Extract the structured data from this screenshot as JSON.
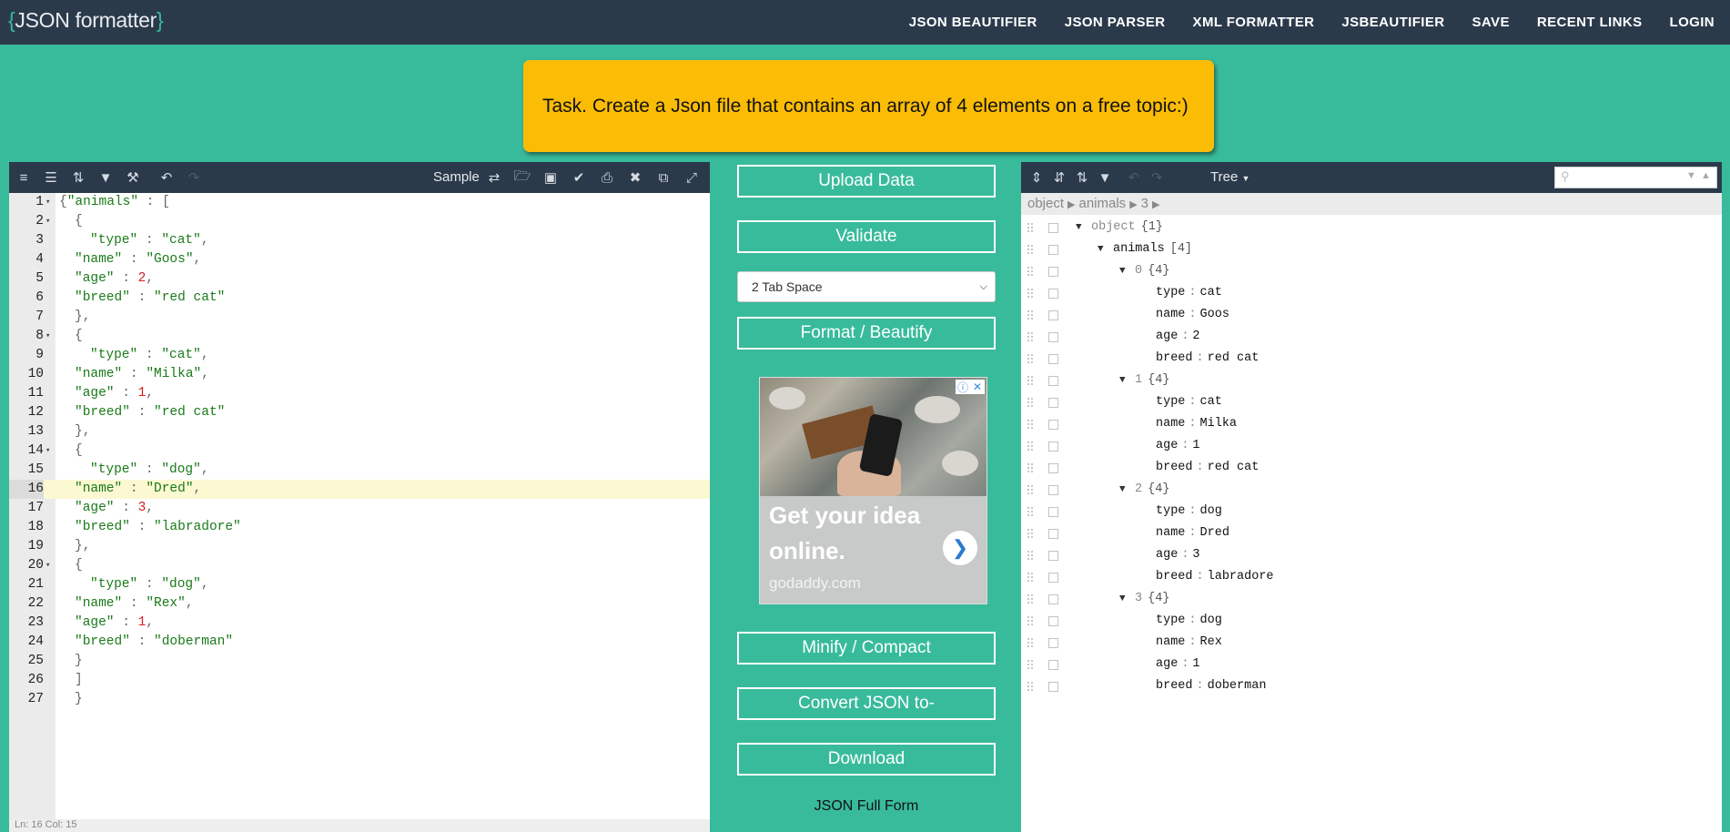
{
  "header": {
    "logo_open": "{",
    "logo_text": "JSON formatter",
    "logo_close": "}",
    "nav": [
      "JSON BEAUTIFIER",
      "JSON PARSER",
      "XML FORMATTER",
      "JSBEAUTIFIER",
      "SAVE",
      "RECENT LINKS",
      "LOGIN"
    ]
  },
  "task": "Task. Create a Json file that contains an array of 4 elements on a free topic:)",
  "editor": {
    "sample_label": "Sample",
    "status": "Ln: 16    Col: 15",
    "active_line": 16,
    "lines": [
      {
        "n": "1",
        "fold": true,
        "indent": 0,
        "parts": [
          {
            "t": "p",
            "v": "{"
          },
          {
            "t": "s",
            "v": "\"animals\""
          },
          {
            "t": "p",
            "v": " : ["
          }
        ]
      },
      {
        "n": "2",
        "fold": true,
        "indent": 1,
        "parts": [
          {
            "t": "p",
            "v": "{"
          }
        ]
      },
      {
        "n": "3",
        "indent": 2,
        "parts": [
          {
            "t": "s",
            "v": "\"type\""
          },
          {
            "t": "p",
            "v": " : "
          },
          {
            "t": "s",
            "v": "\"cat\""
          },
          {
            "t": "p",
            "v": ","
          }
        ]
      },
      {
        "n": "4",
        "indent": 1,
        "parts": [
          {
            "t": "s",
            "v": "\"name\""
          },
          {
            "t": "p",
            "v": " : "
          },
          {
            "t": "s",
            "v": "\"Goos\""
          },
          {
            "t": "p",
            "v": ","
          }
        ]
      },
      {
        "n": "5",
        "indent": 1,
        "parts": [
          {
            "t": "s",
            "v": "\"age\""
          },
          {
            "t": "p",
            "v": " : "
          },
          {
            "t": "n",
            "v": "2"
          },
          {
            "t": "p",
            "v": ","
          }
        ]
      },
      {
        "n": "6",
        "indent": 1,
        "parts": [
          {
            "t": "s",
            "v": "\"breed\""
          },
          {
            "t": "p",
            "v": " : "
          },
          {
            "t": "s",
            "v": "\"red cat\""
          }
        ]
      },
      {
        "n": "7",
        "indent": 1,
        "parts": [
          {
            "t": "p",
            "v": "},"
          }
        ]
      },
      {
        "n": "8",
        "fold": true,
        "indent": 1,
        "parts": [
          {
            "t": "p",
            "v": "{"
          }
        ]
      },
      {
        "n": "9",
        "indent": 2,
        "parts": [
          {
            "t": "s",
            "v": "\"type\""
          },
          {
            "t": "p",
            "v": " : "
          },
          {
            "t": "s",
            "v": "\"cat\""
          },
          {
            "t": "p",
            "v": ","
          }
        ]
      },
      {
        "n": "10",
        "indent": 1,
        "parts": [
          {
            "t": "s",
            "v": "\"name\""
          },
          {
            "t": "p",
            "v": " : "
          },
          {
            "t": "s",
            "v": "\"Milka\""
          },
          {
            "t": "p",
            "v": ","
          }
        ]
      },
      {
        "n": "11",
        "indent": 1,
        "parts": [
          {
            "t": "s",
            "v": "\"age\""
          },
          {
            "t": "p",
            "v": " : "
          },
          {
            "t": "n",
            "v": "1"
          },
          {
            "t": "p",
            "v": ","
          }
        ]
      },
      {
        "n": "12",
        "indent": 1,
        "parts": [
          {
            "t": "s",
            "v": "\"breed\""
          },
          {
            "t": "p",
            "v": " : "
          },
          {
            "t": "s",
            "v": "\"red cat\""
          }
        ]
      },
      {
        "n": "13",
        "indent": 1,
        "parts": [
          {
            "t": "p",
            "v": "},"
          }
        ]
      },
      {
        "n": "14",
        "fold": true,
        "indent": 1,
        "parts": [
          {
            "t": "p",
            "v": "{"
          }
        ]
      },
      {
        "n": "15",
        "indent": 2,
        "parts": [
          {
            "t": "s",
            "v": "\"type\""
          },
          {
            "t": "p",
            "v": " : "
          },
          {
            "t": "s",
            "v": "\"dog\""
          },
          {
            "t": "p",
            "v": ","
          }
        ]
      },
      {
        "n": "16",
        "indent": 1,
        "parts": [
          {
            "t": "s",
            "v": "\"name\""
          },
          {
            "t": "p",
            "v": " : "
          },
          {
            "t": "s",
            "v": "\"Dred\""
          },
          {
            "t": "p",
            "v": ","
          }
        ]
      },
      {
        "n": "17",
        "indent": 1,
        "parts": [
          {
            "t": "s",
            "v": "\"age\""
          },
          {
            "t": "p",
            "v": " : "
          },
          {
            "t": "n",
            "v": "3"
          },
          {
            "t": "p",
            "v": ","
          }
        ]
      },
      {
        "n": "18",
        "indent": 1,
        "parts": [
          {
            "t": "s",
            "v": "\"breed\""
          },
          {
            "t": "p",
            "v": " : "
          },
          {
            "t": "s",
            "v": "\"labradore\""
          }
        ]
      },
      {
        "n": "19",
        "indent": 1,
        "parts": [
          {
            "t": "p",
            "v": "},"
          }
        ]
      },
      {
        "n": "20",
        "fold": true,
        "indent": 1,
        "parts": [
          {
            "t": "p",
            "v": "{"
          }
        ]
      },
      {
        "n": "21",
        "indent": 2,
        "parts": [
          {
            "t": "s",
            "v": "\"type\""
          },
          {
            "t": "p",
            "v": " : "
          },
          {
            "t": "s",
            "v": "\"dog\""
          },
          {
            "t": "p",
            "v": ","
          }
        ]
      },
      {
        "n": "22",
        "indent": 1,
        "parts": [
          {
            "t": "s",
            "v": "\"name\""
          },
          {
            "t": "p",
            "v": " : "
          },
          {
            "t": "s",
            "v": "\"Rex\""
          },
          {
            "t": "p",
            "v": ","
          }
        ]
      },
      {
        "n": "23",
        "indent": 1,
        "parts": [
          {
            "t": "s",
            "v": "\"age\""
          },
          {
            "t": "p",
            "v": " : "
          },
          {
            "t": "n",
            "v": "1"
          },
          {
            "t": "p",
            "v": ","
          }
        ]
      },
      {
        "n": "24",
        "indent": 1,
        "parts": [
          {
            "t": "s",
            "v": "\"breed\""
          },
          {
            "t": "p",
            "v": " : "
          },
          {
            "t": "s",
            "v": "\"doberman\""
          }
        ]
      },
      {
        "n": "25",
        "indent": 1,
        "parts": [
          {
            "t": "p",
            "v": "}"
          }
        ]
      },
      {
        "n": "26",
        "indent": 1,
        "parts": [
          {
            "t": "p",
            "v": "]"
          }
        ]
      },
      {
        "n": "27",
        "indent": 1,
        "parts": [
          {
            "t": "p",
            "v": "}"
          }
        ]
      }
    ]
  },
  "middle": {
    "upload": "Upload Data",
    "validate": "Validate",
    "tab_select": "2 Tab Space",
    "format": "Format / Beautify",
    "minify": "Minify / Compact",
    "convert": "Convert JSON to‑",
    "download": "Download",
    "full_form": "JSON Full Form"
  },
  "ad": {
    "headline": "Get your idea online.",
    "domain": "godaddy.com"
  },
  "tree": {
    "mode": "Tree",
    "breadcrumb": [
      "object",
      "animals",
      "3"
    ],
    "rows": [
      {
        "depth": 0,
        "toggle": true,
        "key": "object",
        "grey": true,
        "count": "{1}"
      },
      {
        "depth": 1,
        "toggle": true,
        "key": "animals",
        "count": "[4]"
      },
      {
        "depth": 2,
        "toggle": true,
        "key": "0",
        "grey": true,
        "count": "{4}"
      },
      {
        "depth": 3,
        "key": "type",
        "value": "cat"
      },
      {
        "depth": 3,
        "key": "name",
        "value": "Goos"
      },
      {
        "depth": 3,
        "key": "age",
        "value": "2"
      },
      {
        "depth": 3,
        "key": "breed",
        "value": "red cat"
      },
      {
        "depth": 2,
        "toggle": true,
        "key": "1",
        "grey": true,
        "count": "{4}"
      },
      {
        "depth": 3,
        "key": "type",
        "value": "cat"
      },
      {
        "depth": 3,
        "key": "name",
        "value": "Milka"
      },
      {
        "depth": 3,
        "key": "age",
        "value": "1"
      },
      {
        "depth": 3,
        "key": "breed",
        "value": "red cat"
      },
      {
        "depth": 2,
        "toggle": true,
        "key": "2",
        "grey": true,
        "count": "{4}"
      },
      {
        "depth": 3,
        "key": "type",
        "value": "dog"
      },
      {
        "depth": 3,
        "key": "name",
        "value": "Dred"
      },
      {
        "depth": 3,
        "key": "age",
        "value": "3"
      },
      {
        "depth": 3,
        "key": "breed",
        "value": "labradore"
      },
      {
        "depth": 2,
        "toggle": true,
        "key": "3",
        "grey": true,
        "count": "{4}"
      },
      {
        "depth": 3,
        "key": "type",
        "value": "dog"
      },
      {
        "depth": 3,
        "key": "name",
        "value": "Rex"
      },
      {
        "depth": 3,
        "key": "age",
        "value": "1"
      },
      {
        "depth": 3,
        "key": "breed",
        "value": "doberman"
      }
    ]
  }
}
